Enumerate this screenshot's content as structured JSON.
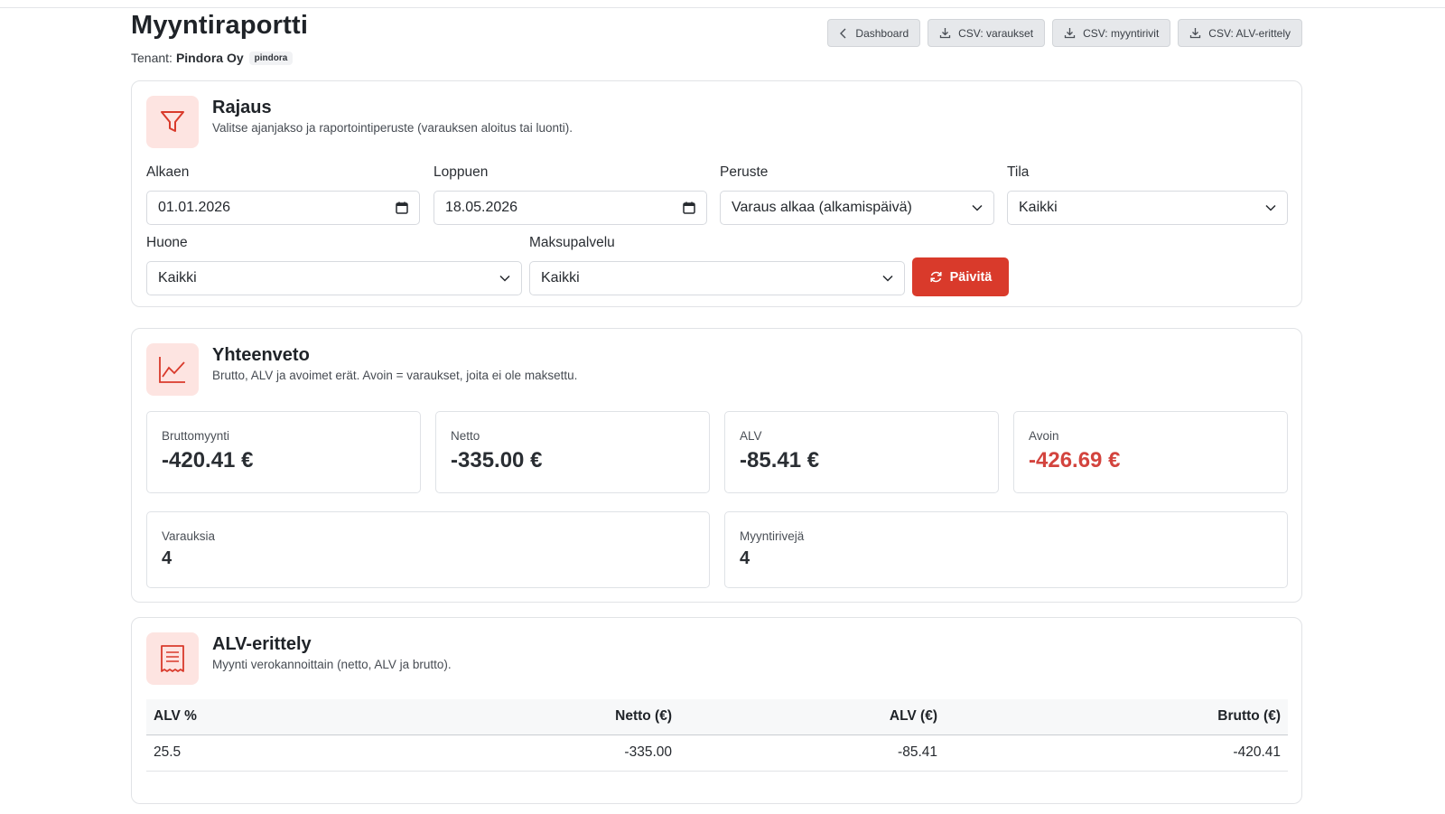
{
  "header": {
    "title": "Myyntiraportti",
    "tenant_label": "Tenant:",
    "tenant_name": "Pindora Oy",
    "tenant_slug": "pindora",
    "buttons": [
      "Dashboard",
      "CSV: varaukset",
      "CSV: myyntirivit",
      "CSV: ALV-erittely"
    ]
  },
  "filter": {
    "title": "Rajaus",
    "subtitle": "Valitse ajanjakso ja raportointiperuste (varauksen aloitus tai luonti).",
    "from_label": "Alkaen",
    "from_value": "01.01.2026",
    "to_label": "Loppuen",
    "to_value": "18.05.2026",
    "basis_label": "Peruste",
    "basis_value": "Varaus alkaa (alkamispäivä)",
    "status_label": "Tila",
    "status_value": "Kaikki",
    "room_label": "Huone",
    "room_value": "Kaikki",
    "payment_label": "Maksupalvelu",
    "payment_value": "Kaikki",
    "refresh_label": "Päivitä"
  },
  "summary": {
    "title": "Yhteenveto",
    "subtitle": "Brutto, ALV ja avoimet erät. Avoin = varaukset, joita ei ole maksettu.",
    "gross_label": "Bruttomyynti",
    "gross_value": "-420.41 €",
    "net_label": "Netto",
    "net_value": "-335.00 €",
    "vat_label": "ALV",
    "vat_value": "-85.41 €",
    "open_label": "Avoin",
    "open_value": "-426.69 €",
    "bookings_label": "Varauksia",
    "bookings_value": "4",
    "rows_label": "Myyntirivejä",
    "rows_value": "4"
  },
  "vat": {
    "title": "ALV-erittely",
    "subtitle": "Myynti verokannoittain (netto, ALV ja brutto).",
    "columns": [
      "ALV %",
      "Netto (€)",
      "ALV (€)",
      "Brutto (€)"
    ],
    "rows": [
      [
        "25.5",
        "-335.00",
        "-85.41",
        "-420.41"
      ]
    ]
  },
  "colors": {
    "accent": "#d93a2b",
    "icon_bg": "#fde4e1",
    "negative": "#d3443e"
  }
}
